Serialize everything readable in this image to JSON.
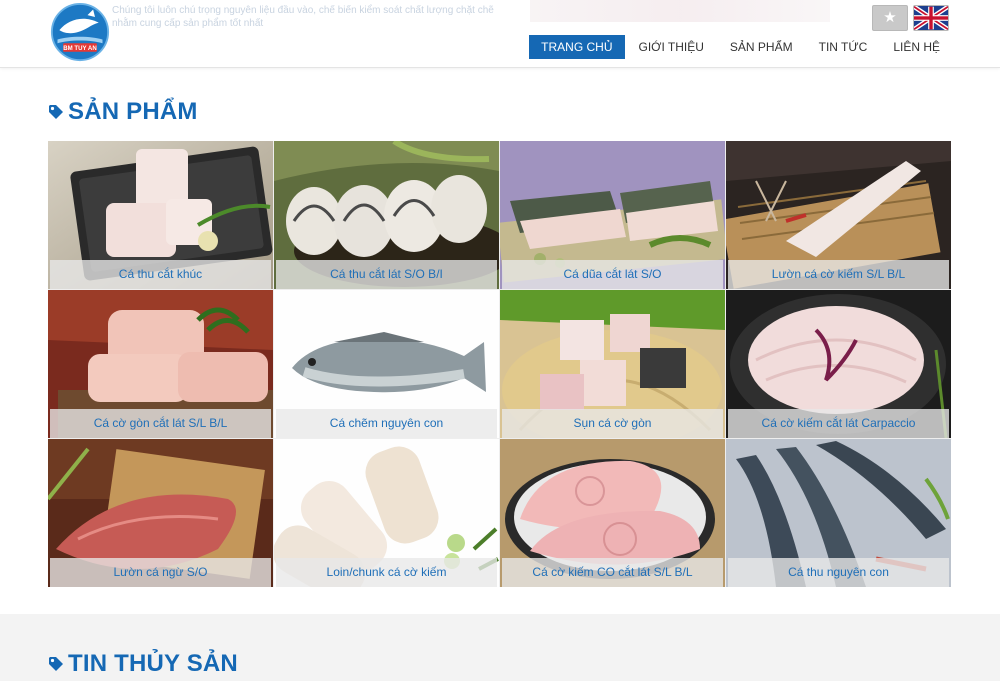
{
  "header": {
    "tagline": "Chúng tôi luôn chú trọng nguyên liệu đầu vào, chế biến kiểm soát chất lượng chặt chẽ nhằm cung cấp sản phẩm tốt nhất",
    "logo_text": "BM TUY AN",
    "nav": [
      "TRANG CHỦ",
      "GIỚI THIỆU",
      "SẢN PHẨM",
      "TIN TỨC",
      "LIÊN HỆ"
    ],
    "active_nav": "TRANG CHỦ",
    "languages": [
      "vietnamese-flag-icon",
      "english-flag-icon"
    ]
  },
  "products_section": {
    "title": "SẢN PHẨM",
    "items": [
      {
        "label": "Cá thu cắt khúc"
      },
      {
        "label": "Cá thu cắt lát S/O B/I"
      },
      {
        "label": "Cá dũa cắt lát S/O"
      },
      {
        "label": "Lườn cá cờ kiếm S/L B/L"
      },
      {
        "label": "Cá cờ gòn cắt lát S/L B/L"
      },
      {
        "label": "Cá chẽm nguyên con"
      },
      {
        "label": "Sụn cá cờ gòn"
      },
      {
        "label": "Cá cờ kiếm cắt lát Carpaccio"
      },
      {
        "label": "Lườn cá ngừ S/O"
      },
      {
        "label": "Loin/chunk cá cờ kiếm"
      },
      {
        "label": "Cá cờ kiếm CO cắt lát S/L B/L"
      },
      {
        "label": "Cá thu nguyên con"
      }
    ]
  },
  "news_section": {
    "title": "TIN THỦY SẢN"
  },
  "colors": {
    "primary": "#1568b4",
    "caption_bg": "#e8e8e8",
    "grey_band": "#f3f3f3"
  }
}
